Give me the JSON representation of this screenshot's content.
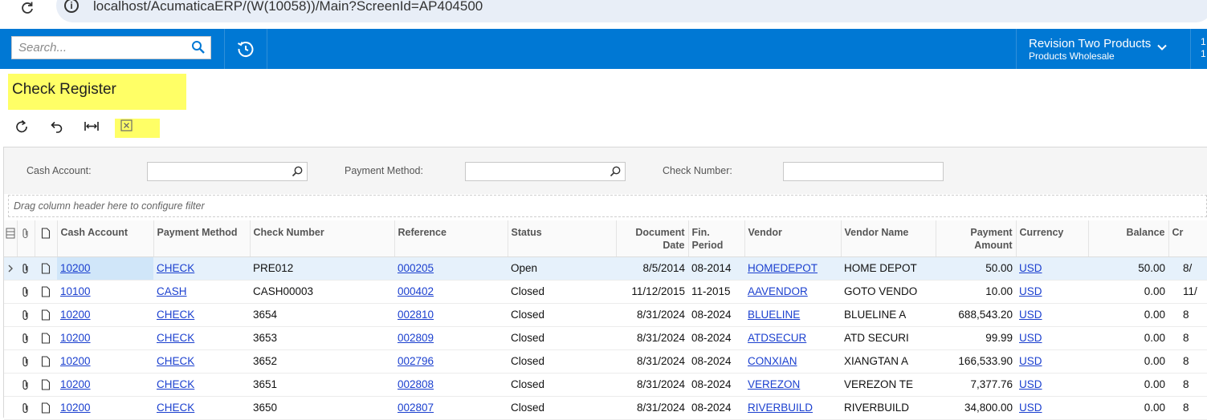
{
  "browser": {
    "url": "localhost/AcumaticaERP/(W(10058))/Main?ScreenId=AP404500",
    "icons": {
      "reload": "reload-icon",
      "info": "site-info-icon"
    }
  },
  "header": {
    "search_placeholder": "Search...",
    "company_name": "Revision Two Products",
    "branch_name": "Products Wholesale",
    "user_fragment_line1": "1",
    "user_fragment_line2": "1",
    "accent_color": "#0078d4"
  },
  "page": {
    "title": "Check Register",
    "highlight_color": "#ffff66"
  },
  "toolbar": {
    "refresh": "refresh-icon",
    "undo": "undo-icon",
    "fit_columns": "fit-columns-icon",
    "export_excel": "excel-export-icon"
  },
  "filters": {
    "cash_account_label": "Cash Account:",
    "cash_account_value": "",
    "payment_method_label": "Payment Method:",
    "payment_method_value": "",
    "check_number_label": "Check Number:",
    "check_number_value": "",
    "drag_hint": "Drag column header here to configure filter"
  },
  "grid": {
    "columns": {
      "cash_account": "Cash Account",
      "payment_method": "Payment Method",
      "check_number": "Check Number",
      "reference": "Reference",
      "status": "Status",
      "document_date_1": "Document",
      "document_date_2": "Date",
      "fin_period_1": "Fin.",
      "fin_period_2": "Period",
      "vendor": "Vendor",
      "vendor_name": "Vendor Name",
      "payment_amount_1": "Payment",
      "payment_amount_2": "Amount",
      "currency": "Currency",
      "balance": "Balance",
      "next": "Cr"
    },
    "rows": [
      {
        "cash_account": "10200",
        "payment_method": "CHECK",
        "check_number": "PRE012",
        "reference": "000205",
        "status": "Open",
        "document_date": "8/5/2014",
        "fin_period": "08-2014",
        "vendor": "HOMEDEPOT",
        "vendor_name": "HOME DEPOT",
        "payment_amount": "50.00",
        "currency": "USD",
        "balance": "50.00",
        "next": "8/"
      },
      {
        "cash_account": "10100",
        "payment_method": "CASH",
        "check_number": "CASH00003",
        "reference": "000402",
        "status": "Closed",
        "document_date": "11/12/2015",
        "fin_period": "11-2015",
        "vendor": "AAVENDOR",
        "vendor_name": "GOTO VENDO",
        "payment_amount": "10.00",
        "currency": "USD",
        "balance": "0.00",
        "next": "11/"
      },
      {
        "cash_account": "10200",
        "payment_method": "CHECK",
        "check_number": "3654",
        "reference": "002810",
        "status": "Closed",
        "document_date": "8/31/2024",
        "fin_period": "08-2024",
        "vendor": "BLUELINE",
        "vendor_name": "BLUELINE A",
        "payment_amount": "688,543.20",
        "currency": "USD",
        "balance": "0.00",
        "next": "8"
      },
      {
        "cash_account": "10200",
        "payment_method": "CHECK",
        "check_number": "3653",
        "reference": "002809",
        "status": "Closed",
        "document_date": "8/31/2024",
        "fin_period": "08-2024",
        "vendor": "ATDSECUR",
        "vendor_name": "ATD SECURI",
        "payment_amount": "99.99",
        "currency": "USD",
        "balance": "0.00",
        "next": "8"
      },
      {
        "cash_account": "10200",
        "payment_method": "CHECK",
        "check_number": "3652",
        "reference": "002796",
        "status": "Closed",
        "document_date": "8/31/2024",
        "fin_period": "08-2024",
        "vendor": "CONXIAN",
        "vendor_name": "XIANGTAN A",
        "payment_amount": "166,533.90",
        "currency": "USD",
        "balance": "0.00",
        "next": "8"
      },
      {
        "cash_account": "10200",
        "payment_method": "CHECK",
        "check_number": "3651",
        "reference": "002808",
        "status": "Closed",
        "document_date": "8/31/2024",
        "fin_period": "08-2024",
        "vendor": "VEREZON",
        "vendor_name": "VEREZON TE",
        "payment_amount": "7,377.76",
        "currency": "USD",
        "balance": "0.00",
        "next": "8"
      },
      {
        "cash_account": "10200",
        "payment_method": "CHECK",
        "check_number": "3650",
        "reference": "002807",
        "status": "Closed",
        "document_date": "8/31/2024",
        "fin_period": "08-2024",
        "vendor": "RIVERBUILD",
        "vendor_name": "RIVERBUILD",
        "payment_amount": "34,800.00",
        "currency": "USD",
        "balance": "0.00",
        "next": "8"
      }
    ]
  }
}
